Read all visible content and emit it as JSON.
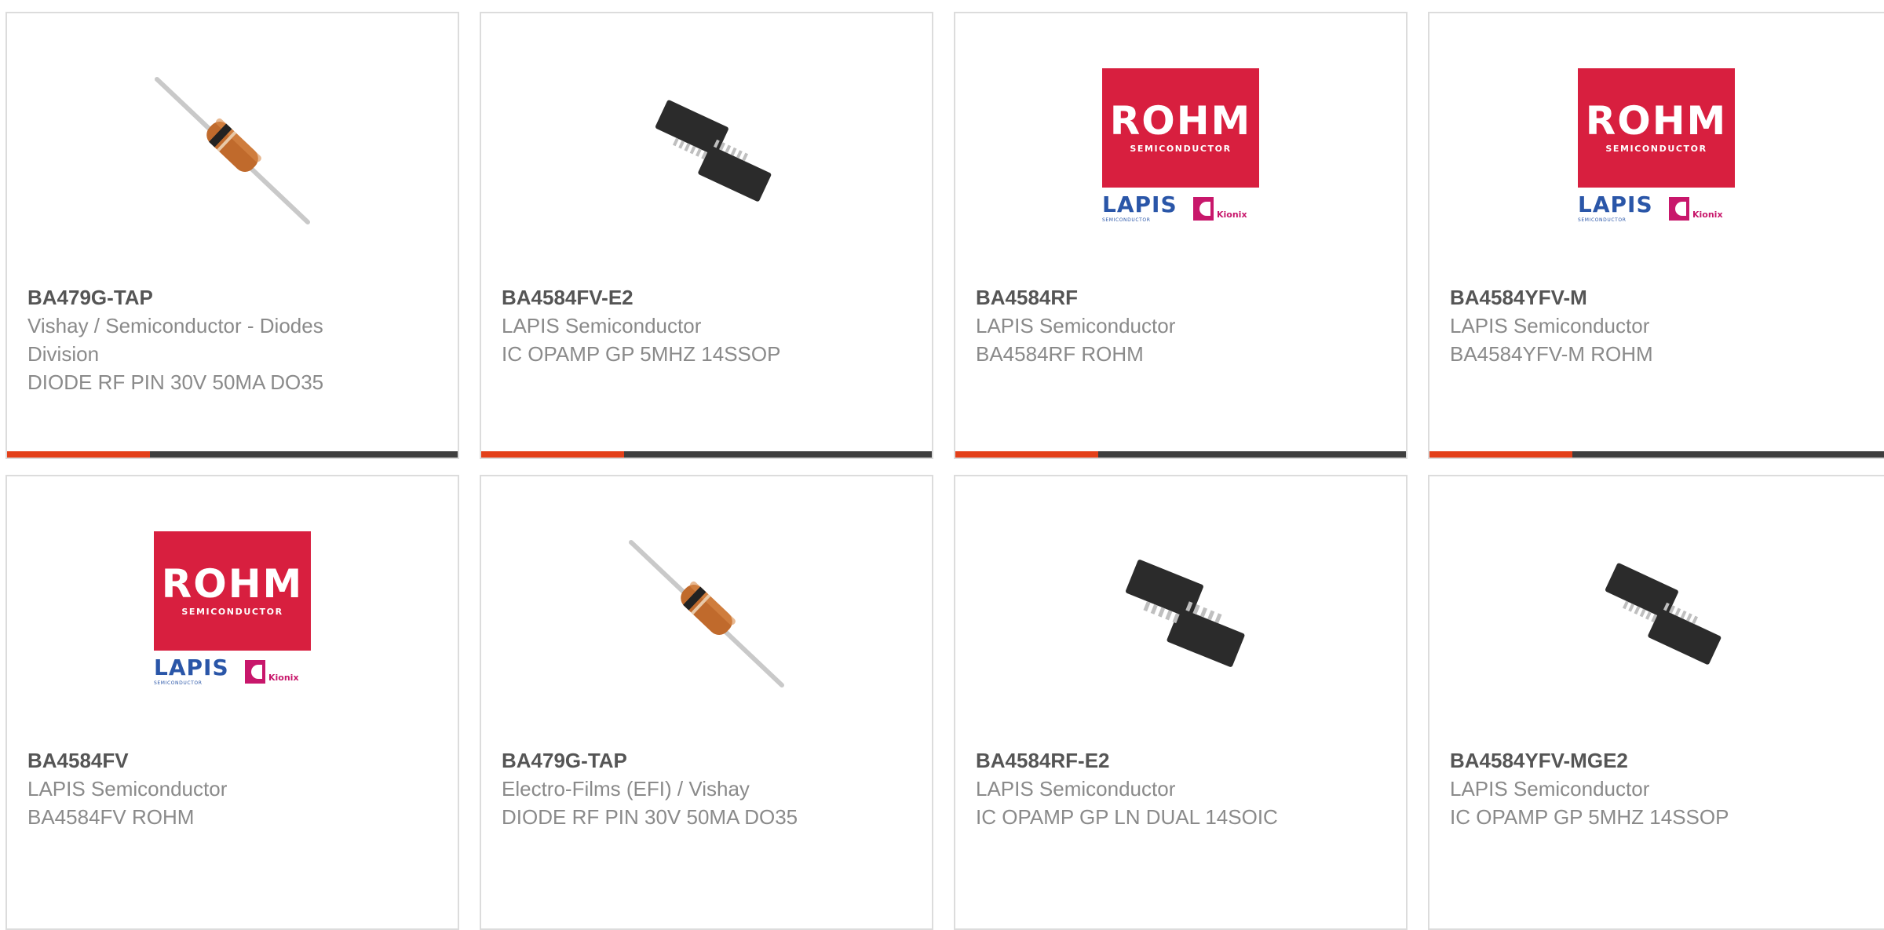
{
  "products": [
    {
      "part_number": "BA479G-TAP",
      "manufacturer": "Vishay / Semiconductor - Diodes Division",
      "description": "DIODE RF PIN 30V 50MA DO35",
      "image": "diode-do35-image"
    },
    {
      "part_number": "BA4584FV-E2",
      "manufacturer": "LAPIS Semiconductor",
      "description": "IC OPAMP GP 5MHZ 14SSOP",
      "image": "ic-ssop-image"
    },
    {
      "part_number": "BA4584RF",
      "manufacturer": "LAPIS Semiconductor",
      "description": "BA4584RF ROHM",
      "image": "rohm-logo-image"
    },
    {
      "part_number": "BA4584YFV-M",
      "manufacturer": "LAPIS Semiconductor",
      "description": "BA4584YFV-M ROHM",
      "image": "rohm-logo-image"
    },
    {
      "part_number": "BA4584FV",
      "manufacturer": "LAPIS Semiconductor",
      "description": "BA4584FV ROHM",
      "image": "rohm-logo-image"
    },
    {
      "part_number": "BA479G-TAP",
      "manufacturer": "Electro-Films (EFI) / Vishay",
      "description": "DIODE RF PIN 30V 50MA DO35",
      "image": "diode-do35-image"
    },
    {
      "part_number": "BA4584RF-E2",
      "manufacturer": "LAPIS Semiconductor",
      "description": "IC OPAMP GP LN DUAL 14SOIC",
      "image": "ic-soic-image"
    },
    {
      "part_number": "BA4584YFV-MGE2",
      "manufacturer": "LAPIS Semiconductor",
      "description": "IC OPAMP GP 5MHZ 14SSOP",
      "image": "ic-ssop-image"
    }
  ],
  "logo_text": {
    "rohm": "ROHM",
    "rohm_sub": "SEMICONDUCTOR",
    "lapis": "LAPIS",
    "lapis_sub": "SEMICONDUCTOR",
    "kionix": "Kionix"
  },
  "colors": {
    "accent": "#e3401a",
    "bar": "#3e3e3e",
    "border": "#dcdcdc",
    "rohm_red": "#d81f3f",
    "lapis_blue": "#2a56a8",
    "kionix_pink": "#c8176b"
  }
}
